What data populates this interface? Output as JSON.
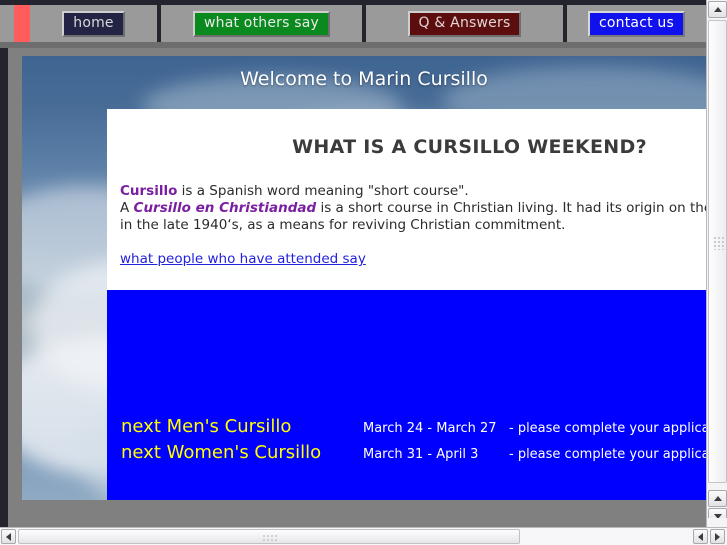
{
  "nav": {
    "items": [
      {
        "label": "home",
        "name": "nav-home"
      },
      {
        "label": "what others say",
        "name": "nav-what-others-say"
      },
      {
        "label": "Q & Answers",
        "name": "nav-q-and-answers"
      },
      {
        "label": "contact us",
        "name": "nav-contact-us"
      }
    ]
  },
  "banner": {
    "title": "Welcome to Marin Cursillo"
  },
  "card": {
    "heading": "WHAT IS A CURSILLO WEEKEND?",
    "line1_kw": "Cursillo",
    "line1_rest": " is a Spanish word meaning \"short course\".",
    "line2_pre": "A ",
    "line2_kw": "Cursillo en Christiandad",
    "line2_rest": " is a short course in Christian living. It had its origin on the island of Majorca",
    "line3": "in the late 1940‘s, as a means for reviving Christian commitment.",
    "link": "what people who have attended say"
  },
  "schedule": {
    "rows": [
      {
        "title": "next Men's Cursillo",
        "dates": "March 24 - March 27",
        "note": "- please complete your application form"
      },
      {
        "title": "next Women's Cursillo",
        "dates": "March 31 - April 3",
        "note": "- please complete your application form"
      }
    ]
  },
  "colors": {
    "accent_red": "#ff5c5c",
    "nav_bar_bg": "#9a9a9a",
    "home_bg": "#232346",
    "others_bg": "#0a8a1e",
    "qa_bg": "#5c0d0d",
    "contact_bg": "#1111ee",
    "panel_blue": "#0000ff",
    "heading_yellow": "#ffff00",
    "link_blue": "#2222dd",
    "keyword_purple": "#7b1fa2",
    "page_gray": "#808080"
  }
}
